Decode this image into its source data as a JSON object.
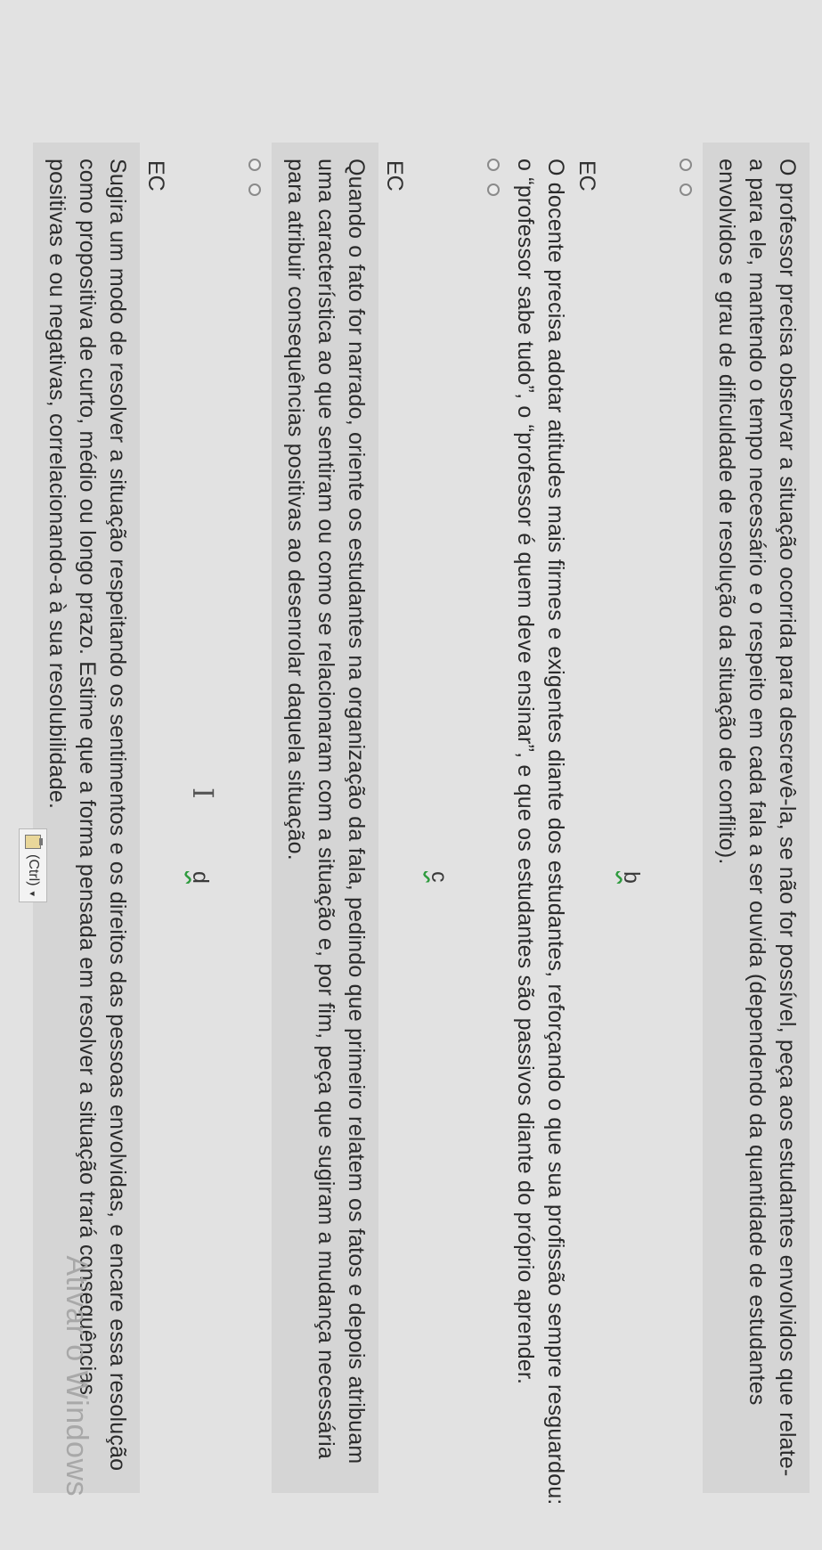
{
  "paragraphs": {
    "a_text": "O professor precisa observar a situação ocorrida para descrevê-la, se não for possível, peça aos estudantes envolvidos que relate-a para ele, mantendo o tempo necessário e o respeito em cada fala a ser ouvida (dependendo da quantidade de estudantes envolvidos e grau de dificuldade de resolução da situação de conflito).",
    "b_text": "O docente precisa adotar atitudes mais firmes e exigentes diante dos estudantes, reforçando o que sua profissão sempre resguardou: o “professor sabe tudo”, o “professor é quem deve ensinar”, e que os estudantes são passivos diante do próprio aprender.",
    "c_text": "Quando o fato for narrado, oriente os estudantes na organização da fala, pedindo que primeiro relatem os fatos e depois atribuam uma característica ao que sentiram ou como se relacionaram com a situação e, por fim, peça que sugiram a mudança necessária para atribuir consequências positivas ao desenrolar daquela situação.",
    "d_text": "Sugira um modo de resolver a situação respeitando os sentimentos e os direitos das pessoas envolvidas, e encare essa resolução como propositiva de curto, médio ou longo prazo. Estime que a forma pensada em resolver a situação trará consequências positivas e ou negativas, correlacionando-a à sua resolubilidade."
  },
  "labels": {
    "b_letter": "b",
    "c_letter": "c",
    "d_letter": "d",
    "ec": "EC"
  },
  "overlay": {
    "watermark": "Ativar o Windows",
    "ctrl_chip": "(Ctrl)"
  },
  "colors": {
    "spell_underline": "#2e9b3e",
    "highlight_band": "#d5d5d5"
  },
  "icons": {
    "radio": "radio-circle",
    "paste_options": "clipboard-icon",
    "text_cursor": "ibeam-icon"
  }
}
